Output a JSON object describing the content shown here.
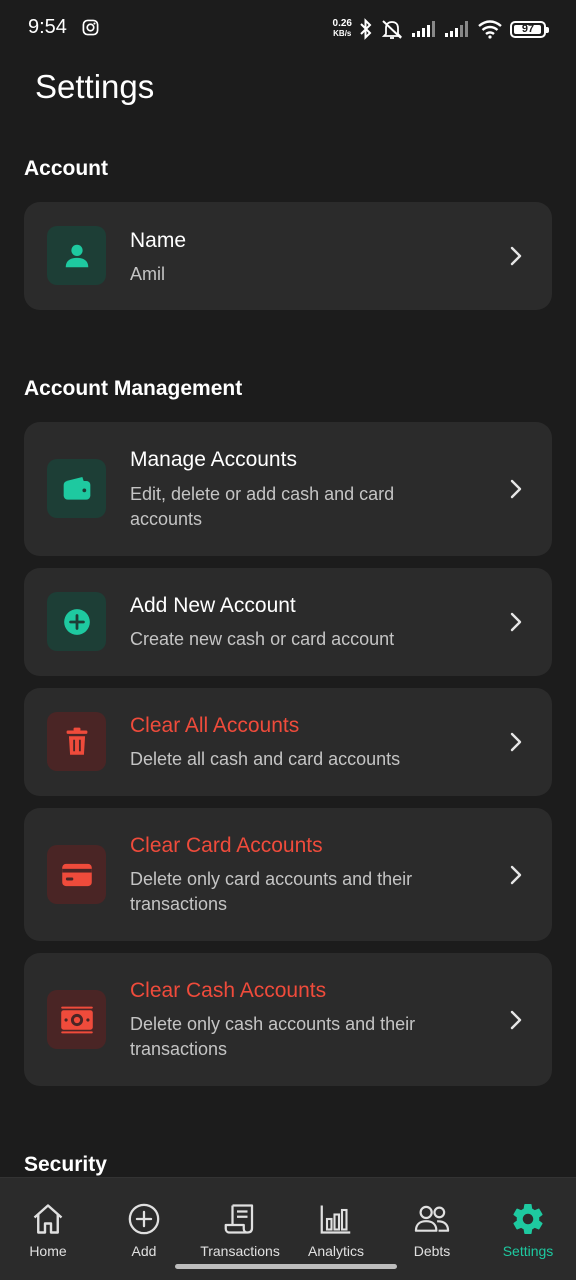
{
  "status_bar": {
    "time": "9:54",
    "net_speed_value": "0.26",
    "net_speed_unit": "KB/s",
    "battery": "97",
    "battery_level": 0.97,
    "icons": [
      "instagram-icon",
      "bluetooth-icon",
      "mute-icon",
      "signal-icon",
      "signal-icon",
      "wifi-icon",
      "battery-icon"
    ]
  },
  "page_title": "Settings",
  "sections": {
    "account": {
      "title": "Account",
      "name_item": {
        "title": "Name",
        "value": "Amil",
        "icon": "person-icon"
      }
    },
    "account_management": {
      "title": "Account Management",
      "items": [
        {
          "title": "Manage Accounts",
          "subtitle": "Edit, delete or add cash and card accounts",
          "icon": "wallet-icon",
          "tone": "green"
        },
        {
          "title": "Add New Account",
          "subtitle": "Create new cash or card account",
          "icon": "add-circle-icon",
          "tone": "green"
        },
        {
          "title": "Clear All Accounts",
          "subtitle": "Delete all cash and card accounts",
          "icon": "trash-icon",
          "tone": "red"
        },
        {
          "title": "Clear Card Accounts",
          "subtitle": "Delete only card accounts and their transactions",
          "icon": "credit-card-icon",
          "tone": "red"
        },
        {
          "title": "Clear Cash Accounts",
          "subtitle": "Delete only cash accounts and their transactions",
          "icon": "cash-icon",
          "tone": "red"
        }
      ]
    },
    "security": {
      "title": "Security"
    }
  },
  "bottom_nav": {
    "items": [
      {
        "label": "Home",
        "icon": "home-icon"
      },
      {
        "label": "Add",
        "icon": "add-circle-icon"
      },
      {
        "label": "Transactions",
        "icon": "receipt-icon"
      },
      {
        "label": "Analytics",
        "icon": "bar-chart-icon"
      },
      {
        "label": "Debts",
        "icon": "people-icon"
      },
      {
        "label": "Settings",
        "icon": "gear-icon",
        "active": true
      }
    ]
  },
  "colors": {
    "background": "#1c1c1c",
    "card": "#2b2b2b",
    "accent": "#1ec9a0",
    "danger": "#ef4b3b",
    "icon_green_bg": "#1d3e36",
    "icon_red_bg": "#4a2525"
  }
}
